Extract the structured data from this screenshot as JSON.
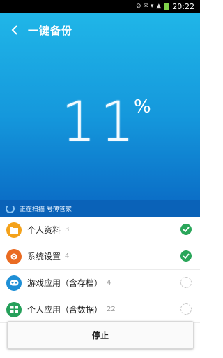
{
  "status_bar": {
    "time": "20:22"
  },
  "header": {
    "title": "一键备份"
  },
  "progress": {
    "value": "11",
    "unit": "%",
    "status_text": "正在扫描 号薄管家"
  },
  "items": [
    {
      "label": "个人资料",
      "count": "3",
      "icon": "folder-icon",
      "color": "#f4a21b",
      "status": "done"
    },
    {
      "label": "系统设置",
      "count": "4",
      "icon": "gear-icon",
      "color": "#ea6b22",
      "status": "done"
    },
    {
      "label": "游戏应用（含存档）",
      "count": "4",
      "icon": "gamepad-icon",
      "color": "#1e8fd6",
      "status": "pending"
    },
    {
      "label": "个人应用（含数据）",
      "count": "22",
      "icon": "apps-grid-icon",
      "color": "#25a05a",
      "status": "pending"
    }
  ],
  "stop_button": {
    "label": "停止"
  }
}
